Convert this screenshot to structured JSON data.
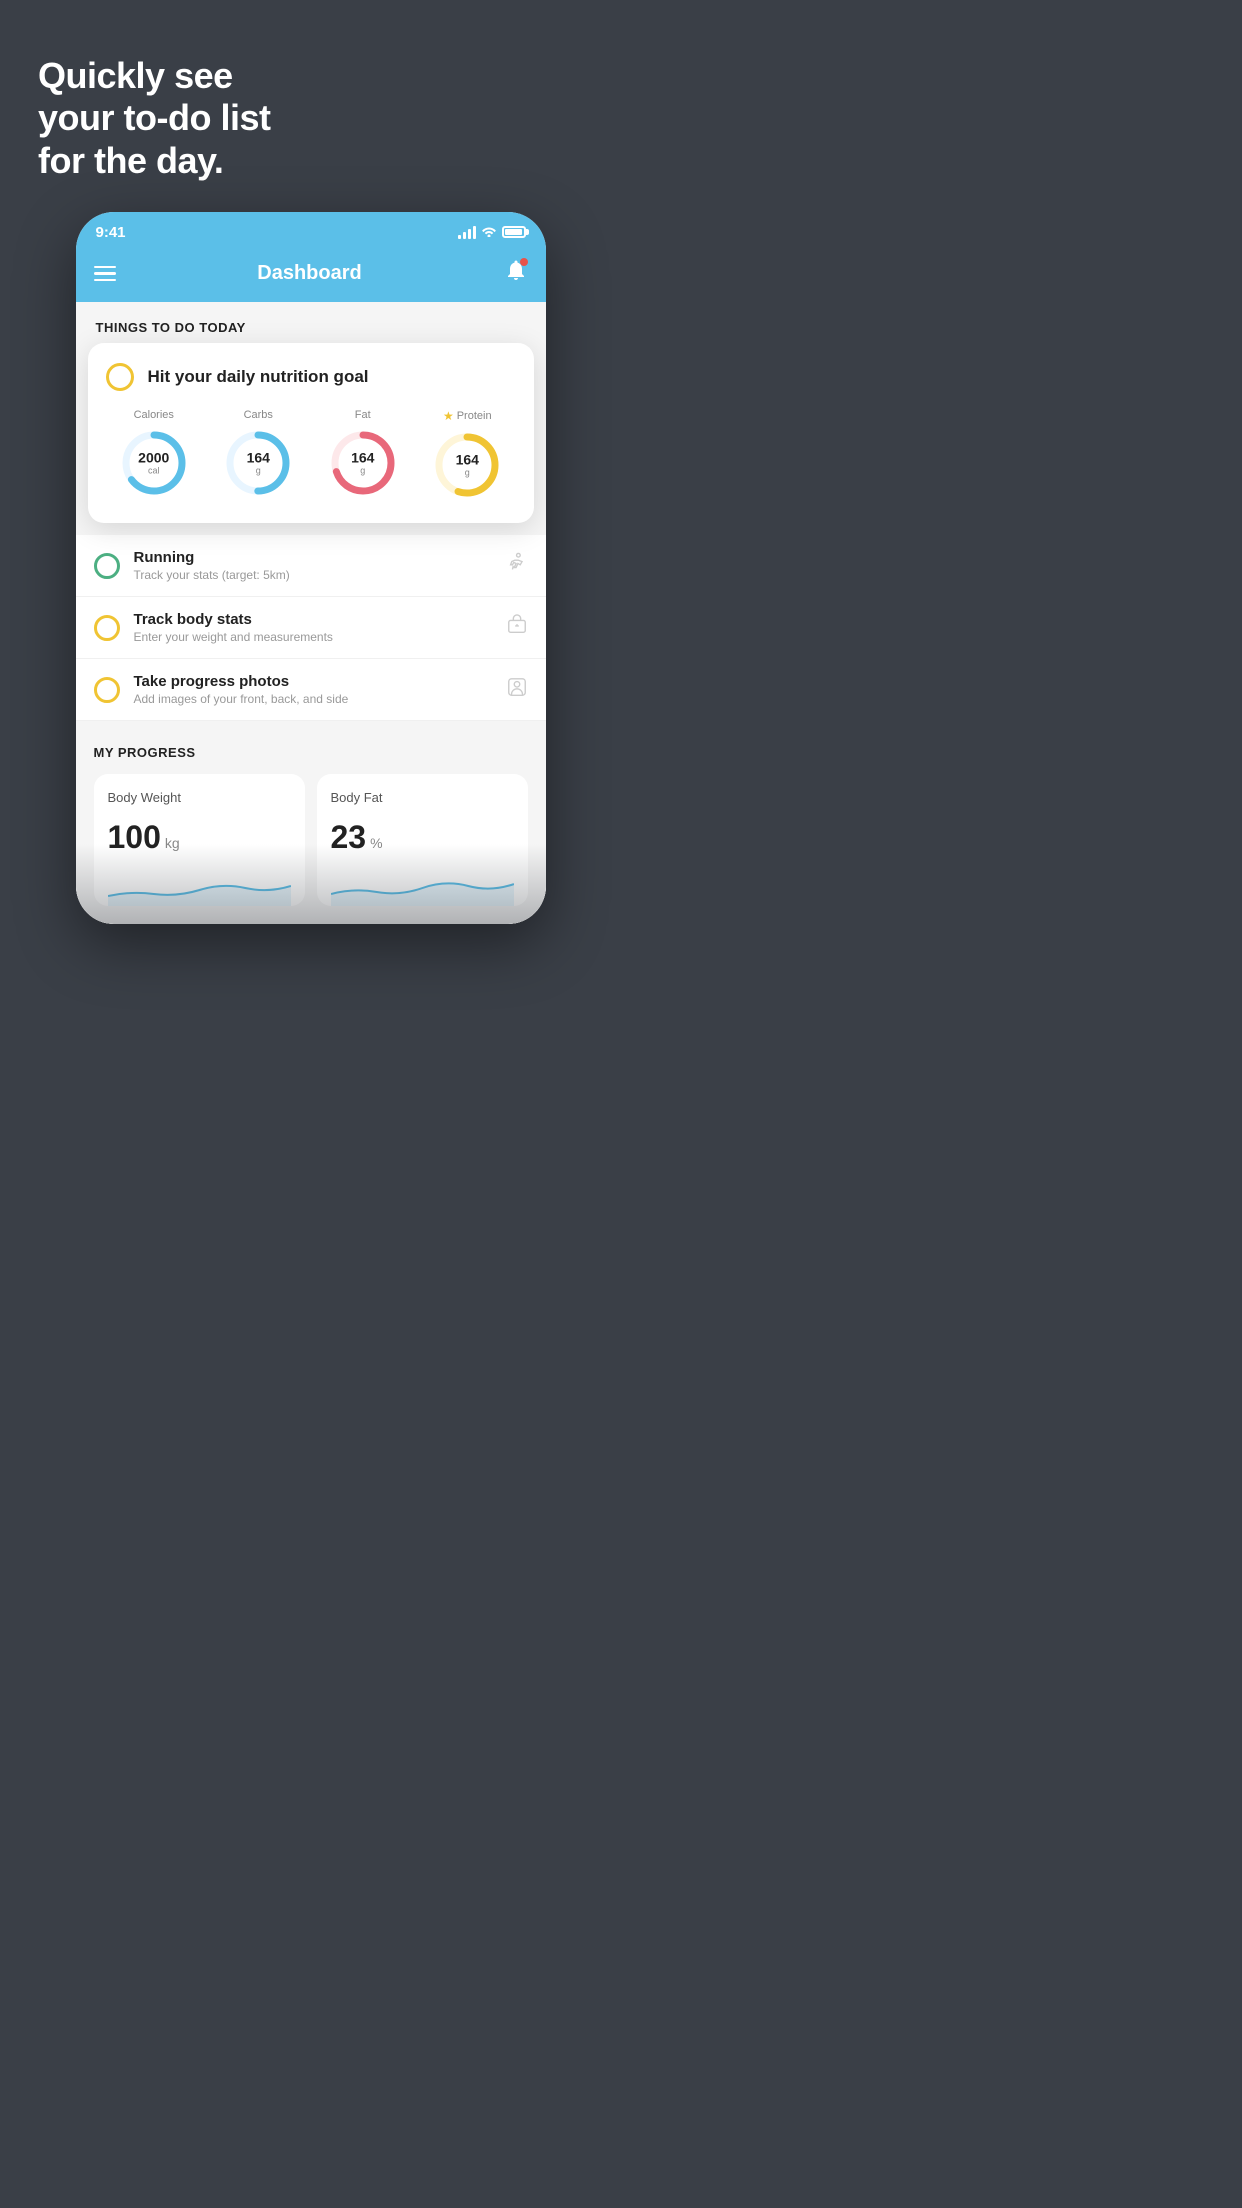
{
  "headline": {
    "line1": "Quickly see",
    "line2": "your to-do list",
    "line3": "for the day."
  },
  "status_bar": {
    "time": "9:41"
  },
  "nav": {
    "title": "Dashboard"
  },
  "things_section": {
    "title": "THINGS TO DO TODAY"
  },
  "nutrition_card": {
    "checkbox_color": "#f0c433",
    "title": "Hit your daily nutrition goal",
    "stats": [
      {
        "label": "Calories",
        "value": "2000",
        "unit": "cal",
        "color": "#5bbfe8",
        "pct": 65
      },
      {
        "label": "Carbs",
        "value": "164",
        "unit": "g",
        "color": "#5bbfe8",
        "pct": 50
      },
      {
        "label": "Fat",
        "value": "164",
        "unit": "g",
        "color": "#e8687a",
        "pct": 70
      },
      {
        "label": "Protein",
        "value": "164",
        "unit": "g",
        "color": "#f0c433",
        "pct": 55,
        "star": true
      }
    ]
  },
  "todo_items": [
    {
      "name": "Running",
      "sub": "Track your stats (target: 5km)",
      "circle": "green",
      "icon": "shoe"
    },
    {
      "name": "Track body stats",
      "sub": "Enter your weight and measurements",
      "circle": "yellow",
      "icon": "scale"
    },
    {
      "name": "Take progress photos",
      "sub": "Add images of your front, back, and side",
      "circle": "yellow",
      "icon": "person"
    }
  ],
  "progress": {
    "title": "MY PROGRESS",
    "cards": [
      {
        "title": "Body Weight",
        "value": "100",
        "unit": "kg"
      },
      {
        "title": "Body Fat",
        "value": "23",
        "unit": "%"
      }
    ]
  }
}
